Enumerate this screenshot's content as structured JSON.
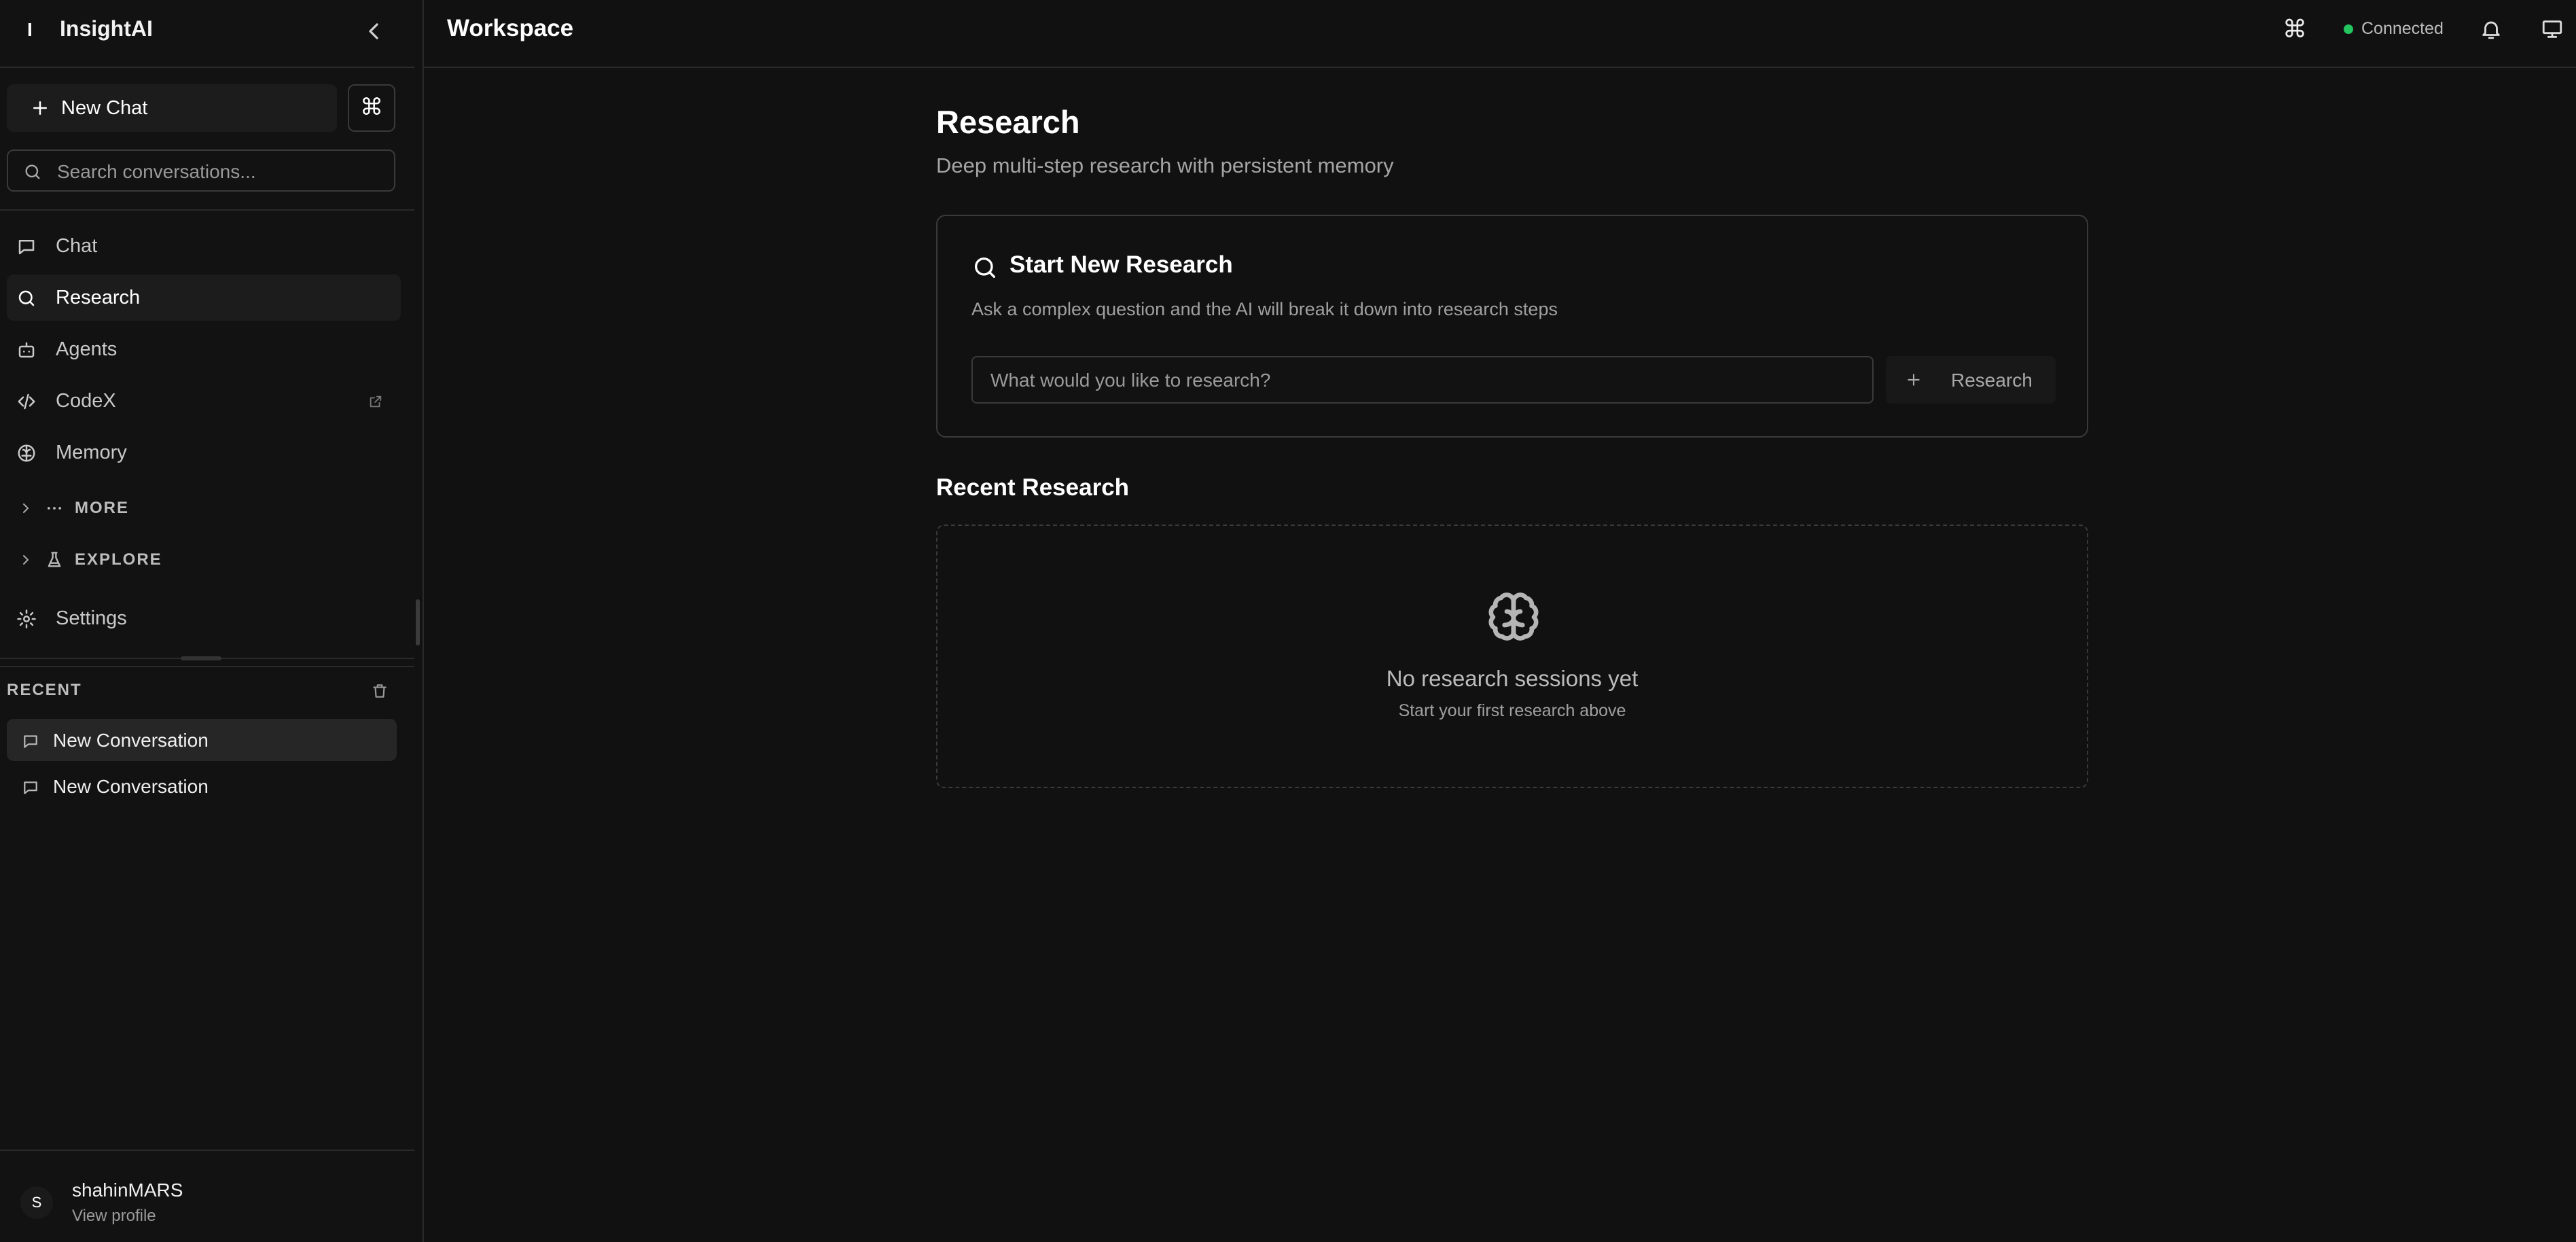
{
  "app": {
    "logo_mark": "I",
    "name": "InsightAI"
  },
  "sidebar": {
    "new_chat_label": "New Chat",
    "command_glyph": "⌘",
    "search_placeholder": "Search conversations...",
    "nav": [
      {
        "label": "Chat",
        "icon": "message-icon"
      },
      {
        "label": "Research",
        "icon": "search-icon",
        "active": true
      },
      {
        "label": "Agents",
        "icon": "bot-icon"
      },
      {
        "label": "CodeX",
        "icon": "code-icon",
        "external": true
      },
      {
        "label": "Memory",
        "icon": "brain-icon"
      }
    ],
    "groups": [
      {
        "label": "MORE",
        "icon": "ellipsis-icon"
      },
      {
        "label": "EXPLORE",
        "icon": "flask-icon"
      }
    ],
    "settings_label": "Settings",
    "recent_label": "RECENT",
    "recent": [
      {
        "label": "New Conversation",
        "active": true
      },
      {
        "label": "New Conversation",
        "active": false
      }
    ],
    "user": {
      "initial": "S",
      "name": "shahinMARS",
      "profile_link": "View profile"
    }
  },
  "header": {
    "title": "Workspace",
    "command_glyph": "⌘",
    "status": "Connected",
    "status_color": "#22c55e"
  },
  "main": {
    "title": "Research",
    "subtitle": "Deep multi-step research with persistent memory",
    "start": {
      "title": "Start New Research",
      "description": "Ask a complex question and the AI will break it down into research steps",
      "input_placeholder": "What would you like to research?",
      "button_label": "Research"
    },
    "recent": {
      "title": "Recent Research",
      "empty_title": "No research sessions yet",
      "empty_subtitle": "Start your first research above"
    }
  }
}
